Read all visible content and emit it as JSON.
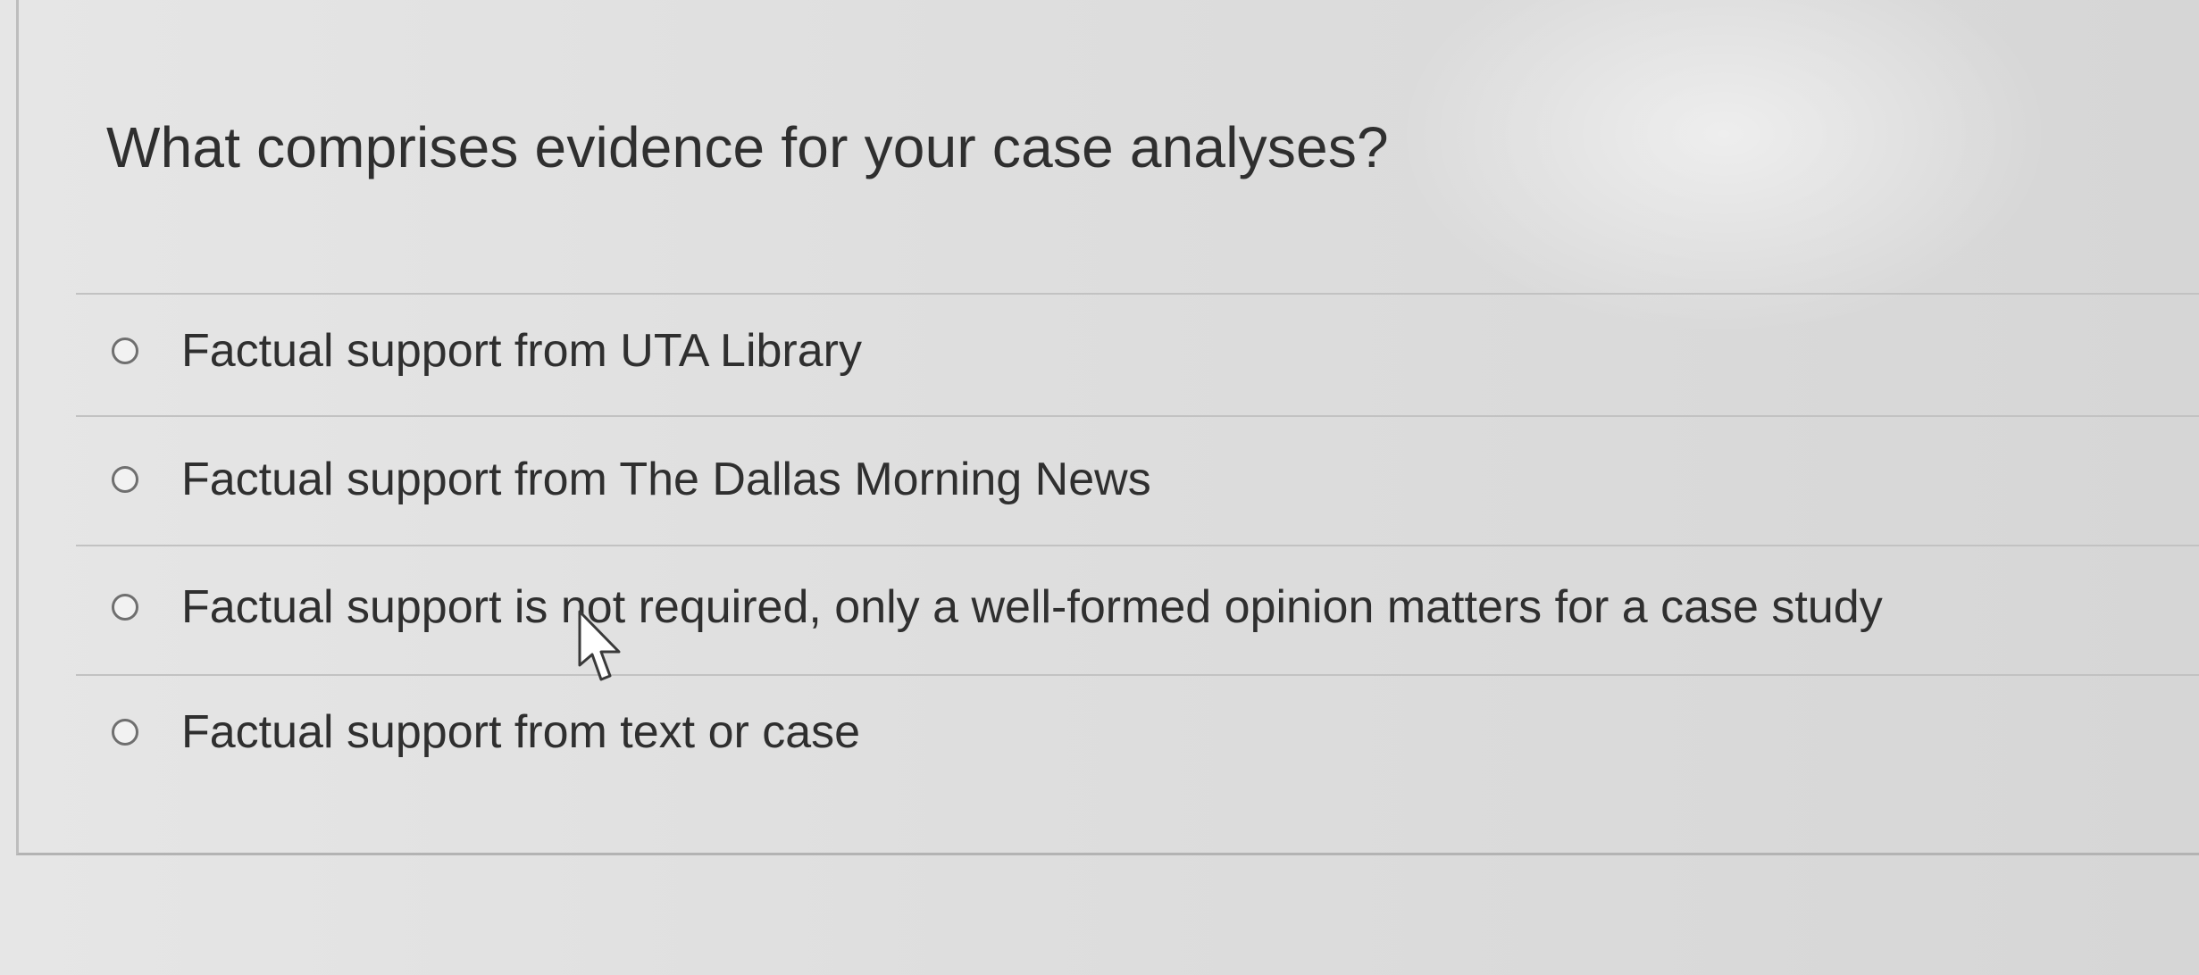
{
  "question": {
    "text": "What comprises evidence for your case analyses?"
  },
  "answers": [
    {
      "label": "Factual support from UTA Library",
      "selected": false
    },
    {
      "label": "Factual support from The Dallas Morning News",
      "selected": false
    },
    {
      "label": "Factual support is not required, only a well-formed opinion matters for a case study",
      "selected": false
    },
    {
      "label": "Factual support from text or case",
      "selected": false
    }
  ],
  "icons": {
    "radio": "radio-button-icon",
    "cursor": "mouse-pointer-icon"
  },
  "colors": {
    "text": "#2f2f2f",
    "radio_border": "#6f6f6f",
    "divider": "#c2c2c2",
    "background": "#e0e0e0"
  }
}
